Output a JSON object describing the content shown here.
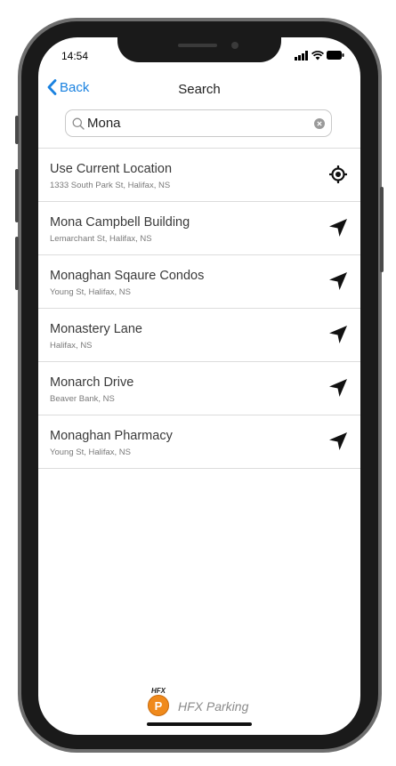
{
  "status_bar": {
    "time": "14:54"
  },
  "nav": {
    "back_label": "Back",
    "title": "Search"
  },
  "search": {
    "value": "Mona",
    "placeholder": "Search"
  },
  "results": [
    {
      "title": "Use Current Location",
      "subtitle": "1333 South Park St, Halifax, NS",
      "icon": "crosshair-location-icon"
    },
    {
      "title": "Mona Campbell Building",
      "subtitle": "Lemarchant St, Halifax, NS",
      "icon": "navigation-arrow-icon"
    },
    {
      "title": "Monaghan Sqaure Condos",
      "subtitle": "Young St, Halifax, NS",
      "icon": "navigation-arrow-icon"
    },
    {
      "title": "Monastery Lane",
      "subtitle": "Halifax, NS",
      "icon": "navigation-arrow-icon"
    },
    {
      "title": "Monarch Drive",
      "subtitle": "Beaver Bank, NS",
      "icon": "navigation-arrow-icon"
    },
    {
      "title": "Monaghan Pharmacy",
      "subtitle": "Young St, Halifax, NS",
      "icon": "navigation-arrow-icon"
    }
  ],
  "footer": {
    "logo_small_text": "HFX",
    "logo_badge_letter": "P",
    "app_name": "HFX Parking"
  },
  "colors": {
    "accent": "#1a82e0",
    "logo_orange": "#f08a1c",
    "frame": "#1a1a1a"
  }
}
